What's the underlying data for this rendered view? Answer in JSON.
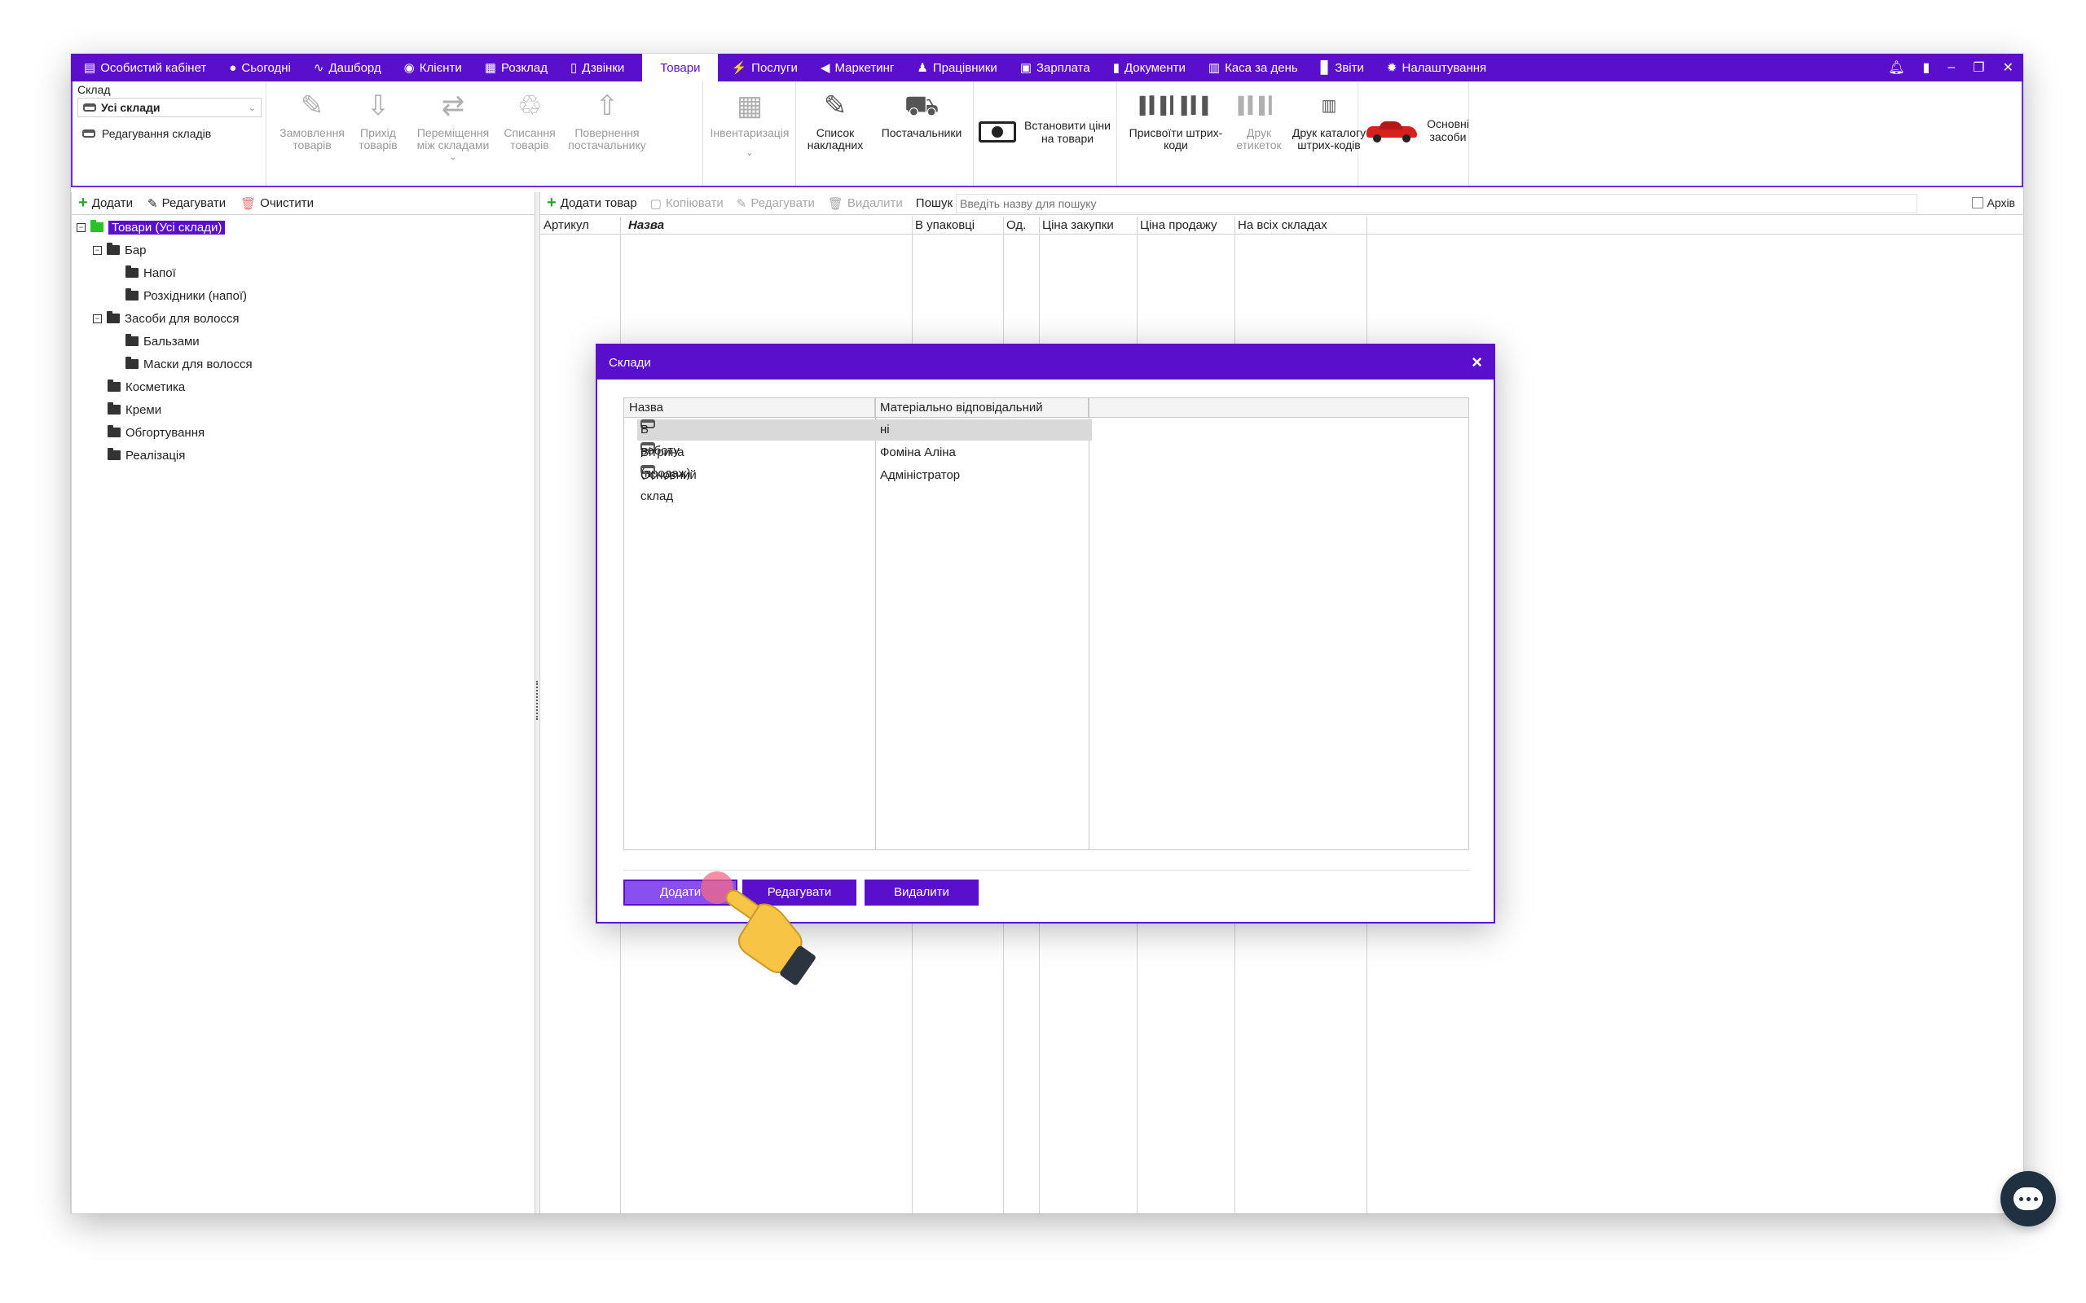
{
  "nav": {
    "items": [
      {
        "label": "Особистий кабінет",
        "icon": "wallet-icon"
      },
      {
        "label": "Сьогодні",
        "icon": "clock-icon"
      },
      {
        "label": "Дашборд",
        "icon": "pulse-icon"
      },
      {
        "label": "Клієнти",
        "icon": "user-circle-icon"
      },
      {
        "label": "Розклад",
        "icon": "calendar-icon"
      },
      {
        "label": "Дзвінки",
        "icon": "phone-icon"
      },
      {
        "label": "Товари",
        "icon": ""
      },
      {
        "label": "Послуги",
        "icon": "bolt-icon"
      },
      {
        "label": "Маркетинг",
        "icon": "megaphone-icon"
      },
      {
        "label": "Працівники",
        "icon": "person-icon"
      },
      {
        "label": "Зарплата",
        "icon": "money-icon"
      },
      {
        "label": "Документи",
        "icon": "file-icon"
      },
      {
        "label": "Каса за день",
        "icon": "calculator-icon"
      },
      {
        "label": "Звіти",
        "icon": "bar-chart-icon"
      },
      {
        "label": "Налаштування",
        "icon": "gear-icon"
      }
    ],
    "active": "Товари",
    "accent": "#5a0fcc"
  },
  "ribbon": {
    "warehouse_label": "Склад",
    "warehouse_value": "Усі склади",
    "edit_warehouses": "Редагування складів",
    "buttons": {
      "order": "Замовлення товарів",
      "receipt": "Прихід товарів",
      "move": "Переміщення між складами",
      "writeoff": "Списання товарів",
      "return": "Повернення постачальнику",
      "inventory": "Інвентаризація",
      "invoices": "Список накладних",
      "suppliers": "Постачальники",
      "set_prices": "Встановити ціни на товари",
      "assign_barcodes": "Присвоїти штрих-коди",
      "print_labels": "Друк етикеток",
      "print_catalog": "Друк каталогу штрих-кодів",
      "fixed_assets": "Основні засоби"
    }
  },
  "left_toolbar": {
    "add": "Додати",
    "edit": "Редагувати",
    "clear": "Очистити"
  },
  "tree": {
    "root": "Товари (Усі склади)",
    "bar": "Бар",
    "drinks": "Напої",
    "drinks_retail": "Розхідники (напої)",
    "hair": "Засоби для волосся",
    "balms": "Бальзами",
    "masks": "Маски для волосся",
    "cosmetics": "Косметика",
    "creams": "Креми",
    "wraps": "Обгортування",
    "sales": "Реалізація"
  },
  "right_toolbar": {
    "add_product": "Додати товар",
    "copy": "Копіювати",
    "edit": "Редагувати",
    "delete": "Видалити",
    "search_label": "Пошук",
    "search_placeholder": "Введіть назву для пошуку",
    "archive": "Архів"
  },
  "grid_headers": {
    "article": "Артикул",
    "name": "Назва",
    "per_pack": "В упаковці",
    "unit": "Од.",
    "purchase_price": "Ціна закупки",
    "sale_price": "Ціна продажу",
    "all_warehouses": "На всіх складах"
  },
  "modal": {
    "title": "Склади",
    "col_name": "Назва",
    "col_responsible": "Матеріально відповідальний",
    "rows": [
      {
        "name": "В роботу",
        "responsible": "ні"
      },
      {
        "name": "Вітрина (продаж)",
        "responsible": "Фоміна Аліна"
      },
      {
        "name": "Основний склад",
        "responsible": "Адміністратор"
      }
    ],
    "add": "Додати",
    "edit": "Редагувати",
    "delete": "Видалити",
    "close": "×"
  }
}
